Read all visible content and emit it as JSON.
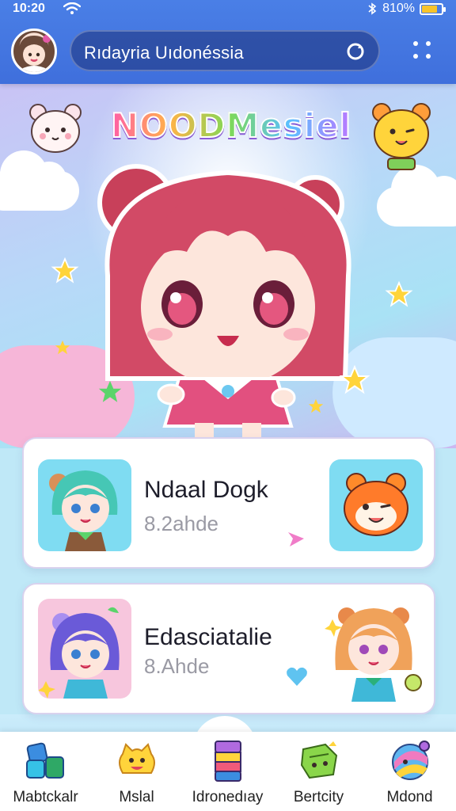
{
  "status_bar": {
    "time": "10:20",
    "battery": "810%",
    "battery_level": 0.8
  },
  "header": {
    "search_text": "Rıdayria Uıdonéssia"
  },
  "hero": {
    "logo_text": "NOODMesiel"
  },
  "cards": [
    {
      "title": "Ndaal Dogk",
      "subtitle": "8.2ahde"
    },
    {
      "title": "Edasciatalie",
      "subtitle": "8.Ahde"
    }
  ],
  "nav": {
    "items": [
      {
        "label": "Mabtckalr"
      },
      {
        "label": "Mslal"
      },
      {
        "label": "Idronedıay"
      },
      {
        "label": "Bertcity"
      },
      {
        "label": "Mdond"
      }
    ]
  },
  "colors": {
    "header_blue": "#4a7fe6",
    "battery_yellow": "#f7c42c"
  }
}
